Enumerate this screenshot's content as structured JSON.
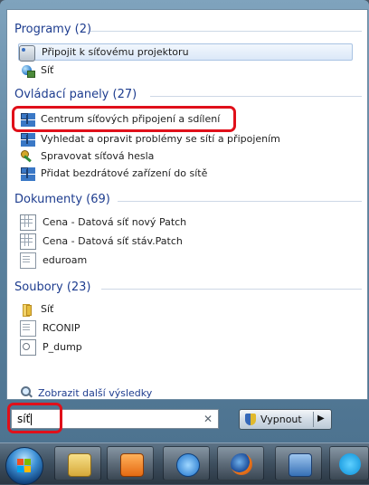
{
  "sections": [
    {
      "header": "Programy (2)",
      "items": [
        {
          "label": "Připojit k síťovému projektoru",
          "icon": "projector-icon"
        },
        {
          "label": "Síť",
          "icon": "network-icon"
        }
      ]
    },
    {
      "header": "Ovládací panely (27)",
      "items": [
        {
          "label": "Centrum síťových připojení a sdílení",
          "icon": "network-center-icon"
        },
        {
          "label": "Vyhledat a opravit problémy se sítí a připojením",
          "icon": "network-center-icon"
        },
        {
          "label": "Spravovat síťová hesla",
          "icon": "key-icon"
        },
        {
          "label": "Přidat bezdrátové zařízení do sítě",
          "icon": "network-center-icon"
        }
      ]
    },
    {
      "header": "Dokumenty (69)",
      "items": [
        {
          "label": "Cena - Datová síť  nový Patch",
          "icon": "spreadsheet-icon"
        },
        {
          "label": "Cena - Datová síť stáv.Patch",
          "icon": "spreadsheet-icon"
        },
        {
          "label": "eduroam",
          "icon": "document-icon"
        }
      ]
    },
    {
      "header": "Soubory (23)",
      "items": [
        {
          "label": "Síť",
          "icon": "folder-icon"
        },
        {
          "label": "RCONIP",
          "icon": "document-icon"
        },
        {
          "label": "P_dump",
          "icon": "dump-file-icon"
        }
      ]
    }
  ],
  "more_results": "Zobrazit další výsledky",
  "search": {
    "value": "síť"
  },
  "shutdown": {
    "label": "Vypnout"
  },
  "taskbar": {
    "apps": [
      "windows-explorer-icon",
      "media-player-icon",
      "internet-explorer-icon",
      "firefox-icon",
      "remote-desktop-icon",
      "skype-icon"
    ]
  }
}
